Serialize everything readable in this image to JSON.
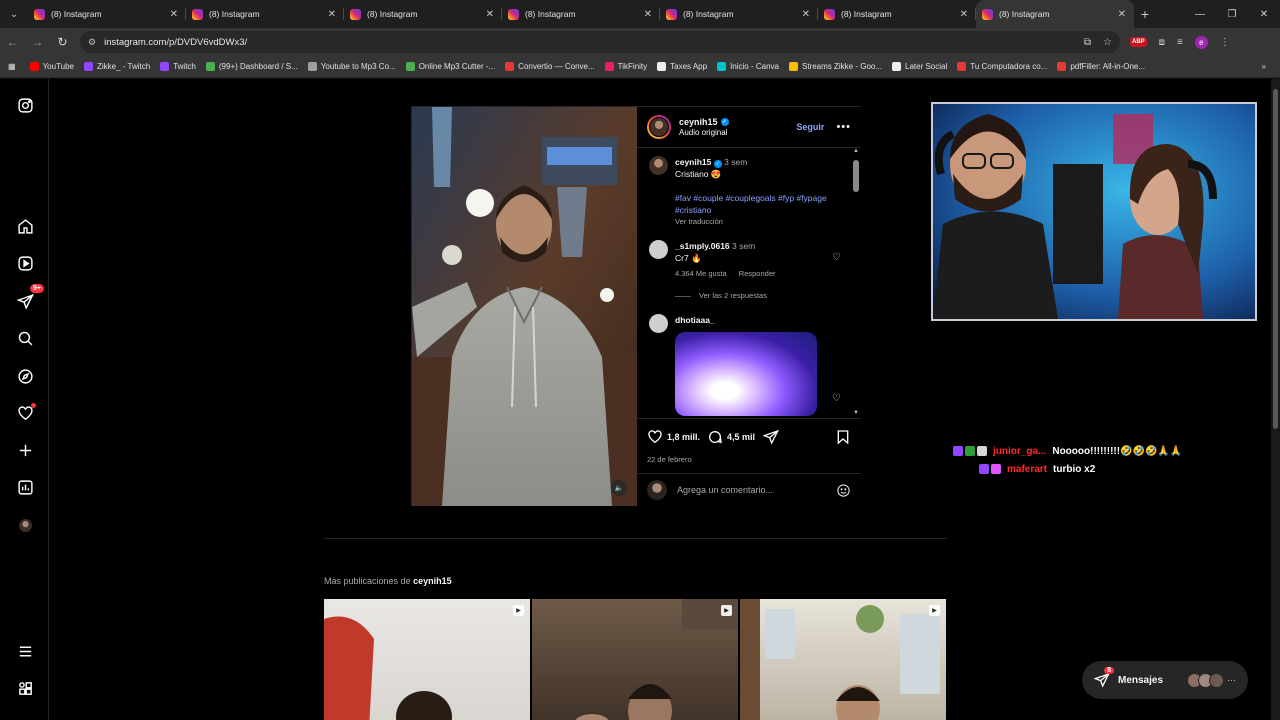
{
  "browser": {
    "tabs": [
      {
        "title": "(8) Instagram",
        "active": false
      },
      {
        "title": "(8) Instagram",
        "active": false
      },
      {
        "title": "(8) Instagram",
        "active": false
      },
      {
        "title": "(8) Instagram",
        "active": false
      },
      {
        "title": "(8) Instagram",
        "active": false
      },
      {
        "title": "(8) Instagram",
        "active": false
      },
      {
        "title": "(8) Instagram",
        "active": true
      }
    ],
    "url": "instagram.com/p/DVDV6vdDWx3/",
    "extension_label": "ABP",
    "profile_initial": "e",
    "bookmarks": [
      {
        "label": "YouTube",
        "color": "#ff0000"
      },
      {
        "label": "Zikke_ - Twitch",
        "color": "#9146ff"
      },
      {
        "label": "Twitch",
        "color": "#9146ff"
      },
      {
        "label": "(99+) Dashboard / S...",
        "color": "#4caf50"
      },
      {
        "label": "Youtube to Mp3 Co...",
        "color": "#9e9e9e"
      },
      {
        "label": "Online Mp3 Cutter -...",
        "color": "#4caf50"
      },
      {
        "label": "Convertio — Conve...",
        "color": "#e53935"
      },
      {
        "label": "TikFinity",
        "color": "#e91e63"
      },
      {
        "label": "Taxes App",
        "color": "#eeeeee"
      },
      {
        "label": "Inicio - Canva",
        "color": "#00c4cc"
      },
      {
        "label": "Streams Zikke - Goo...",
        "color": "#fbbc04"
      },
      {
        "label": "Later Social",
        "color": "#eeeeee"
      },
      {
        "label": "Tu Computadora co...",
        "color": "#e53935"
      },
      {
        "label": "pdfFiller: All-in-One...",
        "color": "#e53935"
      }
    ]
  },
  "sidenav": {
    "notifications_badge": "9+"
  },
  "post": {
    "username": "ceynih15",
    "audio": "Audio original",
    "follow_label": "Seguir",
    "caption": {
      "username": "ceynih15",
      "time": "3 sem",
      "text": "Cristiano 😍",
      "hashtags": "#fav #couple #couplegoals #fyp #fypage #cristiano",
      "translate": "Ver traducción"
    },
    "comments": [
      {
        "username": "_s1mply.0616",
        "time": "3 sem",
        "text": "Cr7 🔥",
        "likes": "4.364 Me gusta",
        "reply": "Responder",
        "view_replies": "Ver las 2 respuestas"
      },
      {
        "username": "dhotiaaa_",
        "time": "",
        "text": ""
      }
    ],
    "likes": "1,8 mill.",
    "comments_count": "4,5 mil",
    "date": "22 de febrero",
    "add_comment_placeholder": "Agrega un comentario..."
  },
  "more_posts": {
    "prefix": "Más publicaciones de",
    "username": "ceynih15"
  },
  "stream_chat": [
    {
      "user": "junior_ga...",
      "message": "Nooooo!!!!!!!!!🤣🤣🤣🙏🙏"
    },
    {
      "user": "maferart",
      "message": "turbio x2"
    }
  ],
  "messages": {
    "label": "Mensajes",
    "badge": "8"
  }
}
